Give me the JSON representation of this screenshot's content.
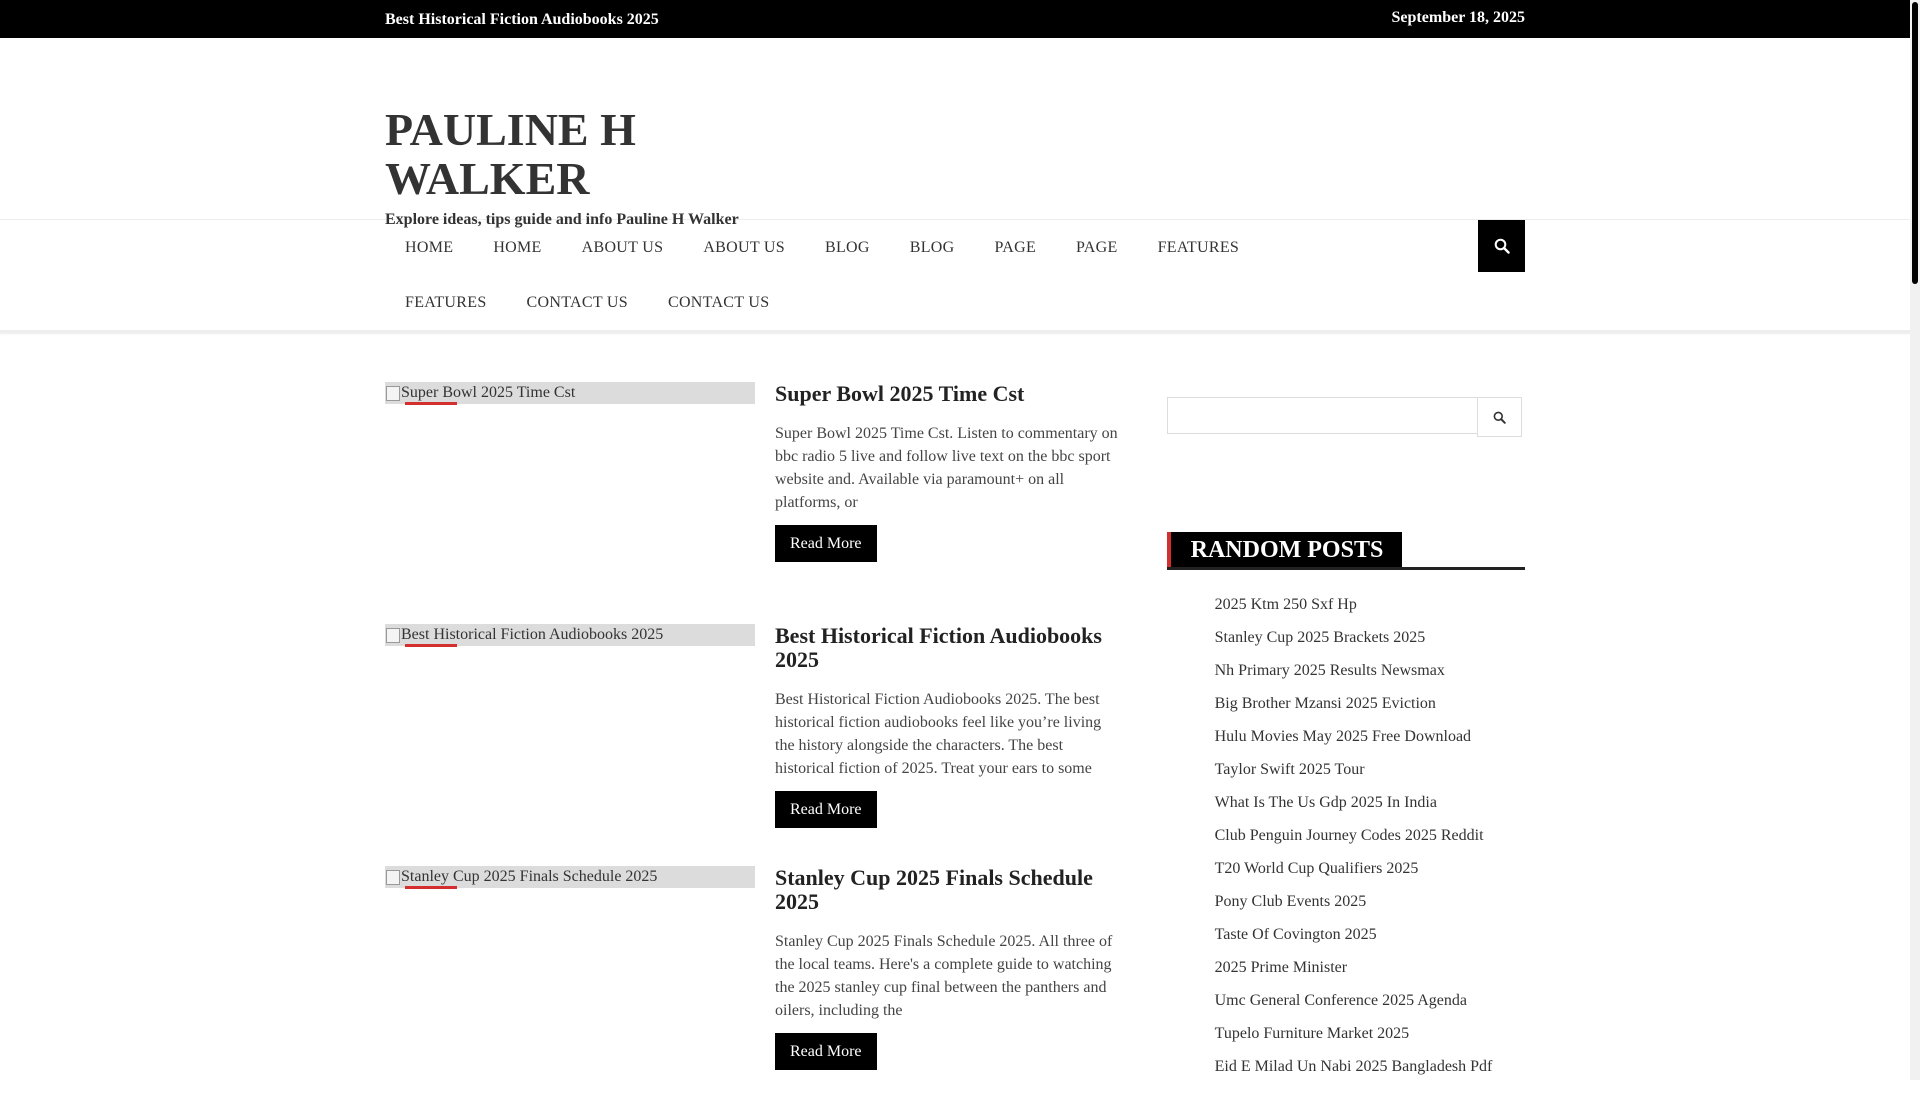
{
  "topbar": {
    "ticker": "Best Historical Fiction Audiobooks 2025",
    "date": "September 18, 2025"
  },
  "header": {
    "title": "PAULINE H WALKER",
    "tagline": "Explore ideas, tips guide and info Pauline H Walker"
  },
  "nav": {
    "items": [
      "HOME",
      "HOME",
      "ABOUT US",
      "ABOUT US",
      "BLOG",
      "BLOG",
      "PAGE",
      "PAGE",
      "FEATURES",
      "FEATURES",
      "CONTACT US",
      "CONTACT US"
    ],
    "search_icon": "search-icon"
  },
  "posts": [
    {
      "thumb_alt": "Super Bowl 2025 Time Cst",
      "title": "Super Bowl 2025 Time Cst",
      "excerpt": "Super Bowl 2025 Time Cst. Listen to commentary on bbc radio 5 live and follow live text on the bbc sport website and. Available via paramount+ on all platforms, or",
      "read_more": "Read More"
    },
    {
      "thumb_alt": "Best Historical Fiction Audiobooks 2025",
      "title": "Best Historical Fiction Audiobooks 2025",
      "excerpt": "Best Historical Fiction Audiobooks 2025. The best historical fiction audiobooks feel like you’re living the history alongside the characters. The best historical fiction of 2025. Treat your ears to some",
      "read_more": "Read More"
    },
    {
      "thumb_alt": "Stanley Cup 2025 Finals Schedule 2025",
      "title": "Stanley Cup 2025 Finals Schedule 2025",
      "excerpt": "Stanley Cup 2025 Finals Schedule 2025. All three of the local teams. Here's a complete guide to watching the 2025 stanley cup final between the panthers and oilers, including the",
      "read_more": "Read More"
    }
  ],
  "sidebar": {
    "search_value": "",
    "random_posts_title": "RANDOM POSTS",
    "random_posts": [
      "2025 Ktm 250 Sxf Hp",
      "Stanley Cup 2025 Brackets 2025",
      "Nh Primary 2025 Results Newsmax",
      "Big Brother Mzansi 2025 Eviction",
      "Hulu Movies May 2025 Free Download",
      "Taylor Swift 2025 Tour",
      "What Is The Us Gdp 2025 In India",
      "Club Penguin Journey Codes 2025 Reddit",
      "T20 World Cup Qualifiers 2025",
      "Pony Club Events 2025",
      "Taste Of Covington 2025",
      "2025 Prime Minister",
      "Umc General Conference 2025 Agenda",
      "Tupelo Furniture Market 2025",
      "Eid E Milad Un Nabi 2025 Bangladesh Pdf"
    ]
  },
  "colors": {
    "accent": "#d32f2f",
    "dark": "#000000"
  }
}
